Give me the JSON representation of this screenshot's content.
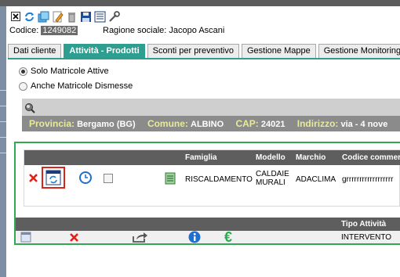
{
  "toolbar": {
    "icons": [
      "close-icon",
      "refresh-icon",
      "new-window-icon",
      "edit-icon",
      "delete-icon",
      "save-icon",
      "list-icon",
      "tools-icon"
    ]
  },
  "header": {
    "code_label": "Codice:",
    "code_value": "1249082",
    "ragione_label": "Ragione sociale:",
    "ragione_value": "Jacopo Ascani"
  },
  "tabs": [
    {
      "label": "Dati cliente",
      "active": false
    },
    {
      "label": "Attività - Prodotti",
      "active": true
    },
    {
      "label": "Sconti per preventivo",
      "active": false
    },
    {
      "label": "Gestione Mappe",
      "active": false
    },
    {
      "label": "Gestione Monitoring",
      "active": false
    }
  ],
  "filters": {
    "solo_attive": "Solo Matricole Attive",
    "anche_dismesse": "Anche Matricole Dismesse",
    "selected": "solo_attive"
  },
  "address": {
    "provincia_label": "Provincia:",
    "provincia_value": "Bergamo (BG)",
    "comune_label": "Comune:",
    "comune_value": "ALBINO",
    "cap_label": "CAP:",
    "cap_value": "24021",
    "indirizzo_label": "Indirizzo:",
    "indirizzo_value": "via - 4 nove"
  },
  "products_table": {
    "columns": [
      "Famiglia",
      "Modello",
      "Marchio",
      "Codice commerci"
    ],
    "rows": [
      {
        "famiglia": "RISCALDAMENTO",
        "modello_line1": "CALDAIE",
        "modello_line2": "MURALI",
        "marchio": "ADACLIMA",
        "codice": "grrrrrrrrrrrrrrrrrr"
      }
    ]
  },
  "activity_table": {
    "columns": [
      "Tipo Attività"
    ],
    "rows": [
      {
        "tipo": "INTERVENTO"
      }
    ]
  },
  "colors": {
    "accent_teal": "#2d9e8f",
    "panel_green": "#32a852",
    "delete_red": "#d9241c",
    "info_blue": "#1f6fd1",
    "euro_green": "#22b04a"
  }
}
